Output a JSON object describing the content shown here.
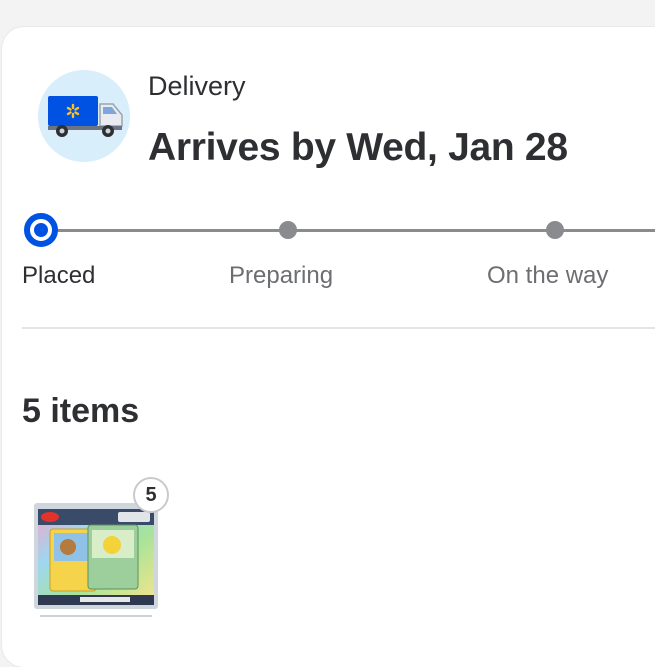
{
  "delivery": {
    "label": "Delivery",
    "arrives_text": "Arrives by Wed, Jan 28",
    "icon": "delivery-truck-icon"
  },
  "progress": {
    "steps": [
      {
        "label": "Placed",
        "state": "active"
      },
      {
        "label": "Preparing",
        "state": "pending"
      },
      {
        "label": "On the way",
        "state": "pending"
      }
    ]
  },
  "items": {
    "count_label": "5 items",
    "list": [
      {
        "quantity": "5",
        "image": "trading-card-pack"
      }
    ]
  },
  "colors": {
    "accent": "#0053e2",
    "icon_bg": "#d8eefa",
    "track": "#8a8b8e",
    "text": "#2e2f32",
    "muted": "#6d6e71"
  }
}
